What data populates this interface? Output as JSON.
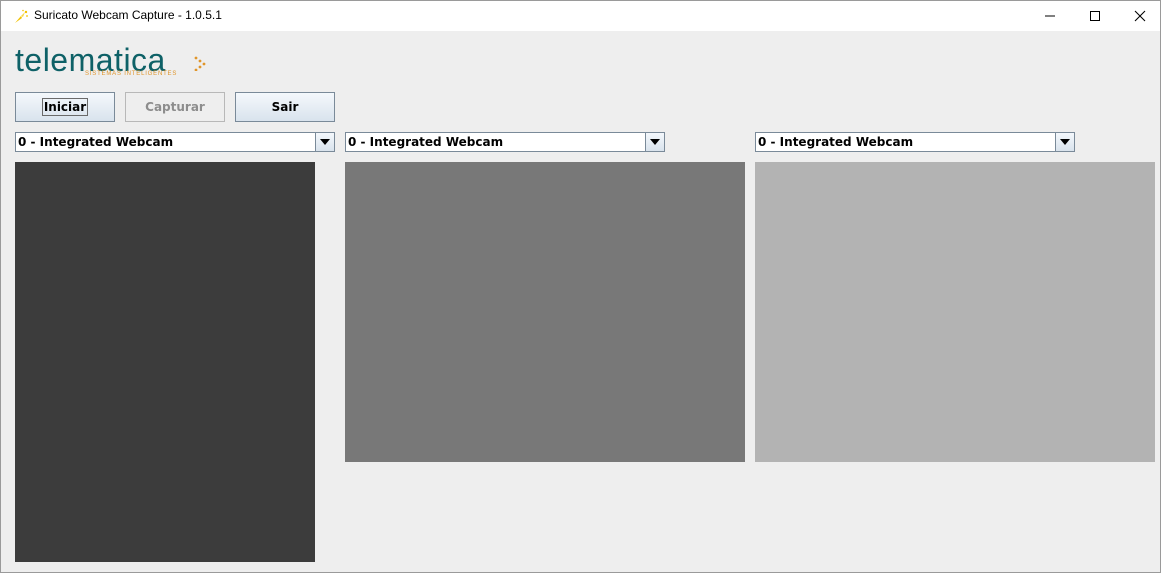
{
  "window": {
    "title": "Suricato Webcam Capture - 1.0.5.1",
    "icon": "suricato-sparkle-icon",
    "controls": [
      "minimize-icon",
      "maximize-icon",
      "close-icon"
    ]
  },
  "logo": {
    "brand": "telematica",
    "tagline": "SISTEMAS INTELIGENTES",
    "primary_color": "#0e6167",
    "accent_color": "#e0952a"
  },
  "toolbar": {
    "start_label": "Iniciar",
    "capture_label": "Capturar",
    "capture_enabled": false,
    "exit_label": "Sair"
  },
  "cameras": [
    {
      "selected": "0 - Integrated Webcam",
      "preview_color": "#3c3c3c"
    },
    {
      "selected": "0 - Integrated Webcam",
      "preview_color": "#787878"
    },
    {
      "selected": "0 - Integrated Webcam",
      "preview_color": "#b3b3b3"
    }
  ]
}
